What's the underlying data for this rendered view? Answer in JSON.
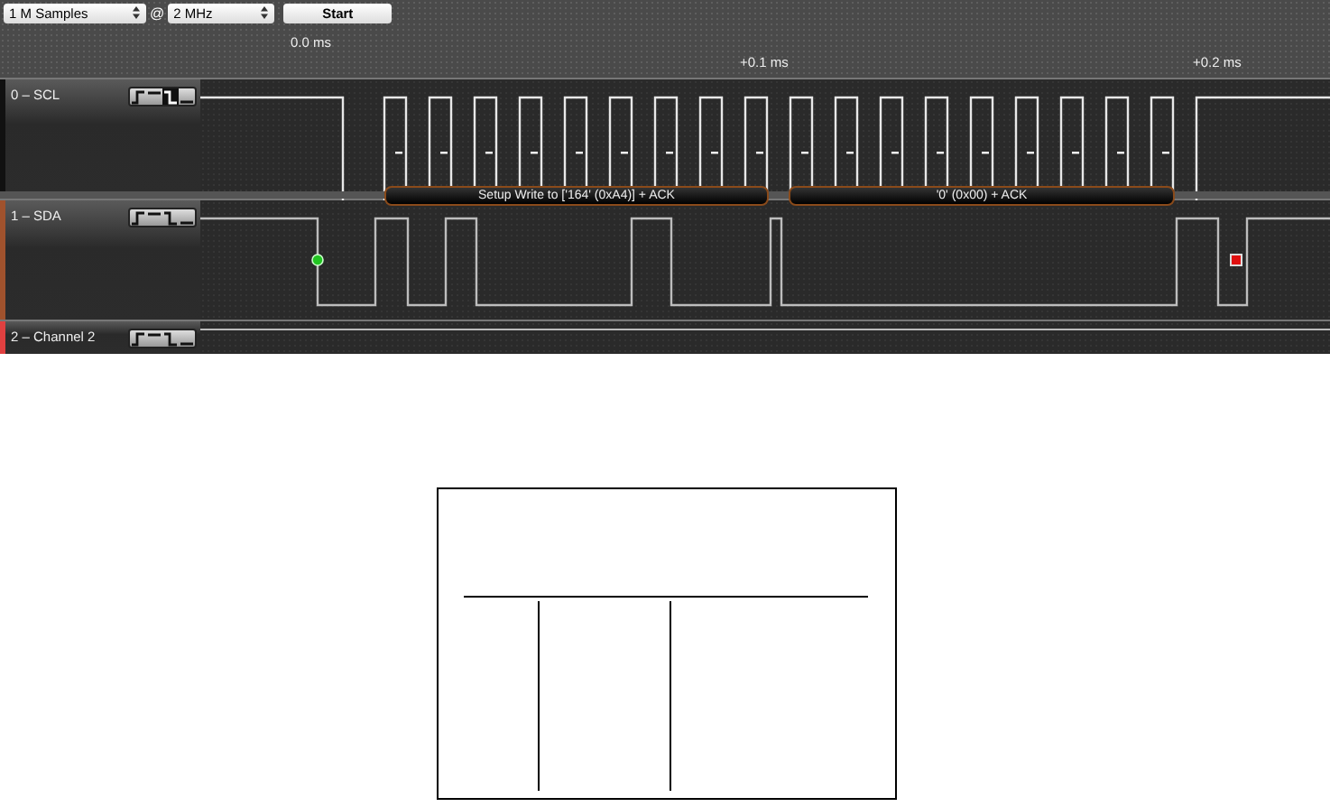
{
  "toolbar": {
    "sample_depth": "1 M Samples",
    "separator": "@",
    "sample_rate": "2 MHz",
    "start_button": "Start"
  },
  "timeline": {
    "labels": [
      "0.0 ms",
      "+0.1 ms",
      "+0.2 ms"
    ]
  },
  "channels": [
    {
      "label": "0 – SCL",
      "color": "#111111",
      "trigger_buttons": [
        {
          "kind": "rising",
          "selected": false
        },
        {
          "kind": "high",
          "selected": false
        },
        {
          "kind": "falling",
          "selected": true
        },
        {
          "kind": "low",
          "selected": false
        }
      ]
    },
    {
      "label": "1 – SDA",
      "color": "#a0522d",
      "trigger_buttons": [
        {
          "kind": "rising",
          "selected": false
        },
        {
          "kind": "high",
          "selected": false
        },
        {
          "kind": "falling",
          "selected": false
        },
        {
          "kind": "low",
          "selected": false
        }
      ]
    },
    {
      "label": "2 – Channel 2",
      "color": "#e04040",
      "trigger_buttons": [
        {
          "kind": "rising",
          "selected": false
        },
        {
          "kind": "high",
          "selected": false
        },
        {
          "kind": "falling",
          "selected": false
        },
        {
          "kind": "low",
          "selected": false
        }
      ]
    }
  ],
  "decodes": [
    "Setup Write to ['164' (0xA4)] + ACK",
    "'0' (0x00) + ACK"
  ]
}
